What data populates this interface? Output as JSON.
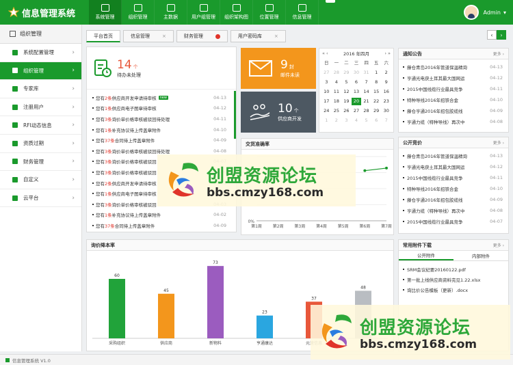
{
  "app": {
    "title": "信息管理系统",
    "user": "Admin",
    "footer": "信息管理系统 V1.0"
  },
  "nav": [
    {
      "label": "系统管理",
      "active": true
    },
    {
      "label": "组织管理"
    },
    {
      "label": "主数据"
    },
    {
      "label": "用户组管理"
    },
    {
      "label": "组织架构图"
    },
    {
      "label": "位置管理"
    },
    {
      "label": "信息管理"
    }
  ],
  "nav_more": "⌄",
  "sidebar": {
    "title": "组织管理",
    "items": [
      {
        "label": "系统配置管理"
      },
      {
        "label": "组织管理",
        "active": true
      },
      {
        "label": "专家库"
      },
      {
        "label": "注册用户"
      },
      {
        "label": "RFI动态信息"
      },
      {
        "label": "资质过期"
      },
      {
        "label": "财务管理"
      },
      {
        "label": "自定义"
      },
      {
        "label": "云平台"
      }
    ]
  },
  "tabs": [
    {
      "label": "平台首页",
      "active": true
    },
    {
      "label": "信息管理",
      "close": "×"
    },
    {
      "label": "财务管理",
      "close": "red"
    },
    {
      "label": "用户密码库",
      "close": "×"
    }
  ],
  "tabnav": {
    "prev": "‹",
    "next": "›"
  },
  "todo": {
    "count": "14",
    "unit": "个",
    "label": "待办未处理",
    "items": [
      {
        "pre": "您有",
        "num": "2条",
        "post": "供应商开发申请待审核",
        "date": "04-13",
        "new": "new"
      },
      {
        "pre": "您有",
        "num": "1条",
        "post": "供应商电子图章待审核",
        "date": "04-12"
      },
      {
        "pre": "您有",
        "num": "3条",
        "post": "询价单价格审核被驳回待处理",
        "date": "04-11"
      },
      {
        "pre": "您有",
        "num": "1条",
        "post": "补充协议待上传盖章附件",
        "date": "04-10"
      },
      {
        "pre": "您有",
        "num": "37条",
        "post": "合同待上传盖章附件",
        "date": "04-09"
      },
      {
        "pre": "您有",
        "num": "3条",
        "post": "询价单价格审核被驳回待处理",
        "date": "04-08"
      },
      {
        "pre": "您有",
        "num": "3条",
        "post": "询价单价格审核被驳回",
        "date": "04-07"
      },
      {
        "pre": "您有",
        "num": "3条",
        "post": "询价单价格审核被驳回",
        "date": "04-06"
      },
      {
        "pre": "您有",
        "num": "2条",
        "post": "供应商开发申请待审核",
        "date": "04-05"
      },
      {
        "pre": "您有",
        "num": "1条",
        "post": "供应商电子图章待审核",
        "date": "04-04"
      },
      {
        "pre": "您有",
        "num": "3条",
        "post": "询价单价格审核被驳回",
        "date": "04-03"
      },
      {
        "pre": "您有",
        "num": "1条",
        "post": "补充协议待上传盖章附件",
        "date": "04-02"
      },
      {
        "pre": "您有",
        "num": "37条",
        "post": "合同待上传盖章附件",
        "date": "04-09"
      }
    ]
  },
  "mail": {
    "count": "9",
    "unit": "封",
    "label": "邮件未读"
  },
  "supplier": {
    "count": "10",
    "unit": "个",
    "label": "供应商开发"
  },
  "calendar": {
    "title": "2016 年四月",
    "prev": "«  ‹",
    "next": "›  »",
    "weekdays": [
      "日",
      "一",
      "二",
      "三",
      "四",
      "五",
      "六"
    ],
    "days": [
      [
        "27",
        "dim"
      ],
      [
        "28",
        "dim"
      ],
      [
        "29",
        "dim"
      ],
      [
        "30",
        "dim"
      ],
      [
        "31",
        "dim"
      ],
      [
        "1",
        ""
      ],
      [
        "2",
        ""
      ],
      [
        "3",
        ""
      ],
      [
        "4",
        ""
      ],
      [
        "5",
        ""
      ],
      [
        "6",
        ""
      ],
      [
        "7",
        ""
      ],
      [
        "8",
        ""
      ],
      [
        "9",
        ""
      ],
      [
        "10",
        ""
      ],
      [
        "11",
        ""
      ],
      [
        "12",
        ""
      ],
      [
        "13",
        ""
      ],
      [
        "14",
        ""
      ],
      [
        "15",
        ""
      ],
      [
        "16",
        ""
      ],
      [
        "17",
        ""
      ],
      [
        "18",
        ""
      ],
      [
        "19",
        ""
      ],
      [
        "20",
        "today"
      ],
      [
        "21",
        ""
      ],
      [
        "22",
        ""
      ],
      [
        "23",
        ""
      ],
      [
        "24",
        ""
      ],
      [
        "25",
        ""
      ],
      [
        "26",
        ""
      ],
      [
        "27",
        ""
      ],
      [
        "28",
        ""
      ],
      [
        "29",
        ""
      ],
      [
        "30",
        ""
      ],
      [
        "1",
        "dim"
      ],
      [
        "2",
        "dim"
      ],
      [
        "3",
        "dim"
      ],
      [
        "4",
        "dim"
      ],
      [
        "5",
        "dim"
      ],
      [
        "6",
        "dim"
      ],
      [
        "7",
        "dim"
      ]
    ]
  },
  "notice": {
    "title": "通知公告",
    "more": "更多 ›",
    "items": [
      {
        "text": "藤仓青岛2016年管道保温精询",
        "date": "04-13"
      },
      {
        "text": "亨通光电获土耳其最大国网运",
        "date": "04-12"
      },
      {
        "text": "2015中国线缆行业最具竞争",
        "date": "04-11"
      },
      {
        "text": "特种导线2016年招铁合金",
        "date": "04-10"
      },
      {
        "text": "藤仓亨通2016年招包胶缆线",
        "date": "04-09"
      },
      {
        "text": "亨通力缆（特种导线）再次中",
        "date": "04-08"
      }
    ]
  },
  "bid": {
    "title": "公开竞价",
    "more": "更多 ›",
    "items": [
      {
        "text": "藤仓青岛2016年管道保温精询",
        "date": "04-13"
      },
      {
        "text": "亨通光电获土耳其最大国网运",
        "date": "04-12"
      },
      {
        "text": "2015中国线缆行业最具竞争",
        "date": "04-11"
      },
      {
        "text": "特种导线2016年招铁合金",
        "date": "04-10"
      },
      {
        "text": "藤仓亨通2016年招包胶缆线",
        "date": "04-09"
      },
      {
        "text": "亨通力缆（特种导线）再次中",
        "date": "04-08"
      },
      {
        "text": "2015中国线缆行业最具竞争",
        "date": "04-07"
      }
    ]
  },
  "files": {
    "title": "常用附件下载",
    "more": "更多 ›",
    "tabs": [
      "公开附件",
      "内部附件"
    ],
    "items": [
      "SRM会议纪要20160122.pdf",
      "第一批上线供应商资料完见1.22.xlsx",
      "询比价公告模板（更新）.docx"
    ]
  },
  "watermark": {
    "cn": "创盟资源论坛",
    "url": "bbs.cmzy168.com"
  },
  "chart_data": [
    {
      "type": "line",
      "title": "交货准确率",
      "categories": [
        "第1周",
        "第2周",
        "第3周",
        "第4周",
        "第5周",
        "第6周",
        "第7周"
      ],
      "values": [
        null,
        null,
        null,
        null,
        null,
        78,
        82
      ],
      "ylim": [
        0,
        100
      ],
      "yticks": [
        "0%"
      ],
      "color": "#1a9a2c"
    },
    {
      "type": "bar",
      "title": "询价降本率",
      "categories": [
        "采购组织",
        "供应商",
        "新物料",
        "亨通康达",
        "元速信息",
        ""
      ],
      "values": [
        60,
        45,
        73,
        23,
        37,
        48
      ],
      "colors": [
        "#21a33a",
        "#f3961c",
        "#9b5cbf",
        "#2aa6e0",
        "#e8573a",
        "#b9bdc2"
      ],
      "ylim": [
        0,
        80
      ]
    }
  ]
}
